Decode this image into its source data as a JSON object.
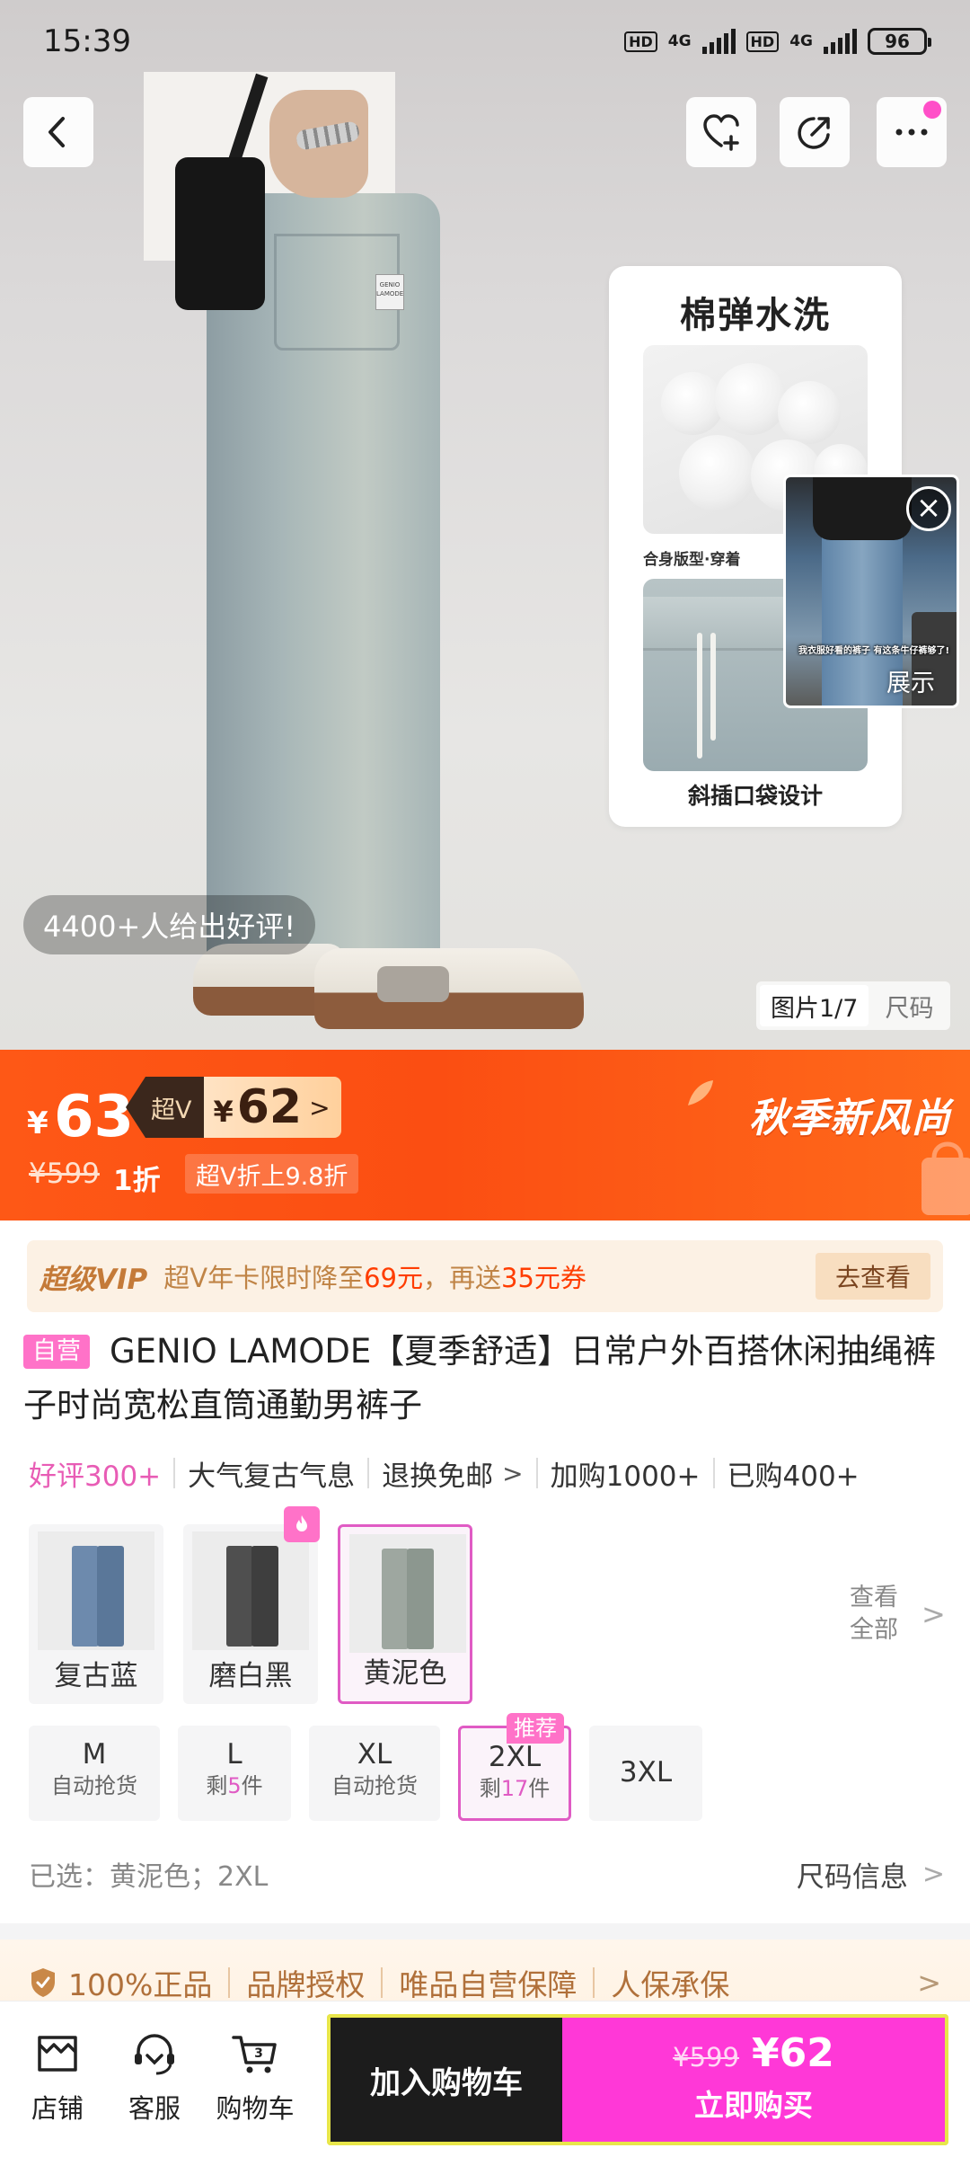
{
  "status_bar": {
    "time": "15:39",
    "sim1_hd": "HD",
    "sim1_net": "4G",
    "sim2_hd": "HD",
    "sim2_net": "4G",
    "battery": "96"
  },
  "hero": {
    "feature_card": {
      "title": "棉弹水洗",
      "subcaption": "合身版型·穿着",
      "caption": "斜插口袋设计"
    },
    "jean_tag_text": "GENIO LAMODE",
    "floating_video": {
      "caption": "我衣服好看的裤子 有这条牛仔裤够了!",
      "label": "展示"
    },
    "review_pill": "4400+人给出好评!",
    "image_indicator": {
      "active": "图片1/7",
      "other": "尺码"
    }
  },
  "price_banner": {
    "currency": "¥",
    "price": "63",
    "svip_tag": "超V",
    "svip_currency": "¥",
    "svip_price": "62",
    "svip_chevron": ">",
    "original_price": "¥599",
    "discount": "1折",
    "svip_note": "超V折上9.8折",
    "slogan": "秋季新风尚"
  },
  "vip_strip": {
    "logo": "超级VIP",
    "text_prefix": "超V年卡限时降至",
    "amount1": "69元",
    "text_middle": "，再送",
    "amount2": "35元券",
    "button": "去查看"
  },
  "product": {
    "badge": "自营",
    "title": "GENIO LAMODE【夏季舒适】日常户外百搭休闲抽绳裤子时尚宽松直筒通勤男裤子"
  },
  "stats": {
    "good_reviews": "好评300+",
    "style": "大气复古气息",
    "return_policy": "退换免邮",
    "added": "加购1000+",
    "bought": "已购400+"
  },
  "colors": {
    "options": [
      {
        "label": "复古蓝",
        "swatch": "#5f7fa3"
      },
      {
        "label": "磨白黑",
        "swatch": "#4a4a4a"
      },
      {
        "label": "黄泥色",
        "swatch": "#8f9a92"
      }
    ],
    "selected_index": 2,
    "view_all_line1": "查看",
    "view_all_line2": "全部"
  },
  "sizes": {
    "options": [
      {
        "name": "M",
        "note": "自动抢货"
      },
      {
        "name": "L",
        "note_prefix": "剩",
        "note_num": "5",
        "note_suffix": "件"
      },
      {
        "name": "XL",
        "note": "自动抢货"
      },
      {
        "name": "2XL",
        "note_prefix": "剩",
        "note_num": "17",
        "note_suffix": "件"
      },
      {
        "name": "3XL"
      }
    ],
    "recommended_badge": "推荐",
    "selected": "2XL"
  },
  "selection": {
    "text": "已选：黄泥色；2XL",
    "size_info": "尺码信息"
  },
  "guarantee": {
    "items": [
      "100%正品",
      "品牌授权",
      "唯品自营保障",
      "人保承保"
    ]
  },
  "bottom_bar": {
    "store": "店铺",
    "service": "客服",
    "cart": "购物车",
    "cart_count": "3",
    "add_to_cart": "加入购物车",
    "buy_orig": "¥599",
    "buy_price": "¥62",
    "buy_now": "立即购买"
  },
  "colors_theme": {
    "accent_pink": "#ff38d7",
    "price_orange": "#fb4e12",
    "vip_gold": "#c08446"
  },
  "icons": [
    "back-icon",
    "favorite-add-icon",
    "share-icon",
    "more-icon",
    "close-icon",
    "shield-icon",
    "store-icon",
    "service-icon",
    "cart-icon",
    "chevron-right-icon",
    "flame-icon"
  ]
}
